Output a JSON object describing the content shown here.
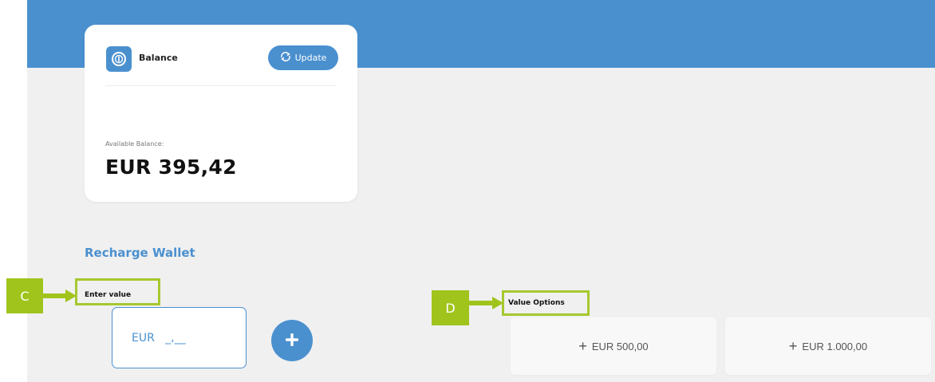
{
  "colors": {
    "primary": "#4a90cf",
    "highlight": "#a6c82e",
    "marker": "#a0c41c",
    "background": "#f0f0f0",
    "card": "#ffffff",
    "option_background": "#f8f8f8"
  },
  "balance_card": {
    "icon": "coin-icon",
    "title": "Balance",
    "update_icon": "refresh-icon",
    "update_label": "Update",
    "available_label": "Available Balance:",
    "amount": "EUR 395,42"
  },
  "recharge": {
    "title": "Recharge Wallet",
    "enter_value_label": "Enter value",
    "input_value": "EUR   _,__",
    "add_icon": "plus-icon"
  },
  "annotations": {
    "marker_c": "C",
    "marker_d": "D"
  },
  "value_options": {
    "label": "Value Options",
    "options": [
      {
        "label": "EUR 500,00"
      },
      {
        "label": "EUR 1.000,00"
      }
    ]
  }
}
